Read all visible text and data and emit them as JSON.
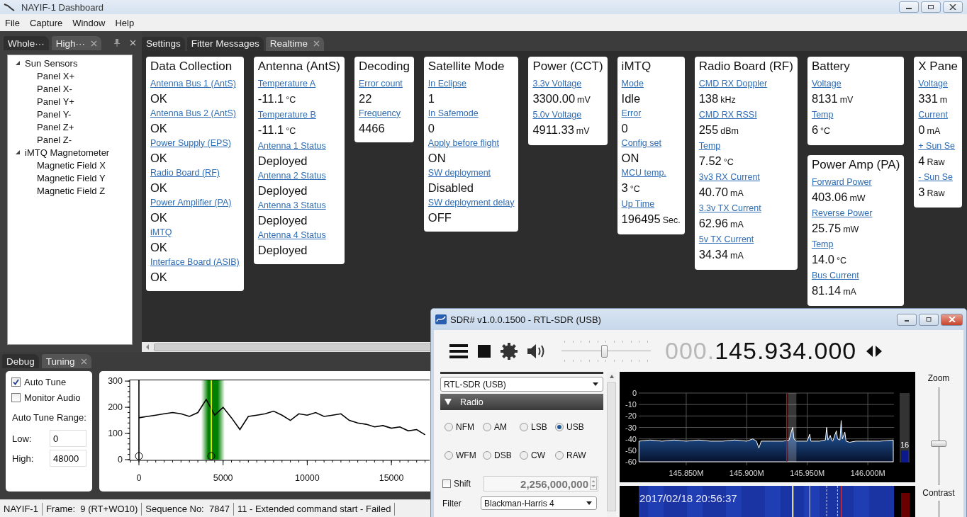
{
  "window": {
    "title": "NAYIF-1 Dashboard"
  },
  "menu": [
    "File",
    "Capture",
    "Window",
    "Help"
  ],
  "left_dock": {
    "tabs": [
      {
        "label": "Whole···",
        "selected": false
      },
      {
        "label": "High···",
        "selected": true
      }
    ],
    "tree": [
      {
        "label": "Sun Sensors",
        "expanded": true,
        "children": [
          {
            "label": "Panel X+"
          },
          {
            "label": "Panel X-"
          },
          {
            "label": "Panel Y+"
          },
          {
            "label": "Panel Y-"
          },
          {
            "label": "Panel Z+"
          },
          {
            "label": "Panel Z-"
          }
        ]
      },
      {
        "label": "iMTQ Magnetometer",
        "expanded": true,
        "children": [
          {
            "label": "Magnetic Field X"
          },
          {
            "label": "Magnetic Field Y"
          },
          {
            "label": "Magnetic Field Z"
          }
        ]
      }
    ]
  },
  "document_tabs": [
    {
      "label": "Settings",
      "selected": false
    },
    {
      "label": "Fitter Messages",
      "selected": false
    },
    {
      "label": "Realtime",
      "selected": true
    }
  ],
  "card_columns": [
    {
      "cards": [
        {
          "title": "Data Collection",
          "fields": [
            {
              "label": "Antenna Bus 1 (AntS)",
              "value": "OK"
            },
            {
              "label": "Antenna Bus 2 (AntS)",
              "value": "OK"
            },
            {
              "label": "Power Supply (EPS)",
              "value": "OK"
            },
            {
              "label": "Radio Board (RF)",
              "value": "OK"
            },
            {
              "label": "Power Amplifier (PA)",
              "value": "OK"
            },
            {
              "label": "iMTQ",
              "value": "OK"
            },
            {
              "label": "Interface Board (ASIB)",
              "value": "OK"
            }
          ]
        }
      ]
    },
    {
      "cards": [
        {
          "title": "Antenna (AntS)",
          "fields": [
            {
              "label": "Temperature A",
              "value": "-11.1",
              "unit": "°C"
            },
            {
              "label": "Temperature B",
              "value": "-11.1",
              "unit": "°C"
            },
            {
              "label": "Antenna 1 Status",
              "value": "Deployed"
            },
            {
              "label": "Antenna 2 Status",
              "value": "Deployed"
            },
            {
              "label": "Antenna 3 Status",
              "value": "Deployed"
            },
            {
              "label": "Antenna 4 Status",
              "value": "Deployed"
            }
          ]
        }
      ]
    },
    {
      "cards": [
        {
          "title": "Decoding",
          "fields": [
            {
              "label": "Error count",
              "value": "22"
            },
            {
              "label": "Frequency",
              "value": "4466"
            }
          ]
        }
      ]
    },
    {
      "cards": [
        {
          "title": "Satellite Mode",
          "fields": [
            {
              "label": "In Eclipse",
              "value": "1"
            },
            {
              "label": "In Safemode",
              "value": "0"
            },
            {
              "label": "Apply before flight",
              "value": "ON"
            },
            {
              "label": "SW deployment",
              "value": "Disabled"
            },
            {
              "label": "SW deployment delay",
              "value": "OFF"
            }
          ]
        }
      ]
    },
    {
      "cards": [
        {
          "title": "Power (CCT)",
          "fields": [
            {
              "label": "3.3v Voltage",
              "value": "3300.00",
              "unit": "mV"
            },
            {
              "label": "5.0v Voltage",
              "value": "4911.33",
              "unit": "mV"
            }
          ]
        }
      ]
    },
    {
      "cards": [
        {
          "title": "iMTQ",
          "fields": [
            {
              "label": "Mode",
              "value": "Idle"
            },
            {
              "label": "Error",
              "value": "0"
            },
            {
              "label": "Config set",
              "value": "ON"
            },
            {
              "label": "MCU temp.",
              "value": "3",
              "unit": "°C"
            },
            {
              "label": "Up Time",
              "value": "196495",
              "unit": "Sec."
            }
          ]
        }
      ]
    },
    {
      "cards": [
        {
          "title": "Radio Board (RF)",
          "fields": [
            {
              "label": "CMD RX Doppler",
              "value": "138",
              "unit": "kHz"
            },
            {
              "label": "CMD RX RSSI",
              "value": "255",
              "unit": "dBm"
            },
            {
              "label": "Temp",
              "value": "7.52",
              "unit": "°C"
            },
            {
              "label": "3v3 RX Current",
              "value": "40.70",
              "unit": "mA"
            },
            {
              "label": "3.3v TX Current",
              "value": "62.96",
              "unit": "mA"
            },
            {
              "label": "5v TX Current",
              "value": "34.34",
              "unit": "mA"
            }
          ]
        }
      ]
    },
    {
      "cards": [
        {
          "title": "Battery",
          "fields": [
            {
              "label": "Voltage",
              "value": "8131",
              "unit": "mV"
            },
            {
              "label": "Temp",
              "value": "6",
              "unit": "°C"
            }
          ]
        },
        {
          "title": "Power Amp (PA)",
          "fields": [
            {
              "label": "Forward Power",
              "value": "403.06",
              "unit": "mW"
            },
            {
              "label": "Reverse Power",
              "value": "25.75",
              "unit": "mW"
            },
            {
              "label": "Temp",
              "value": "14.0",
              "unit": "°C"
            },
            {
              "label": "Bus Current",
              "value": "81.14",
              "unit": "mA"
            }
          ]
        }
      ]
    },
    {
      "cards": [
        {
          "title": "X Pane",
          "fields": [
            {
              "label": "Voltage",
              "value": "331",
              "unit": "m"
            },
            {
              "label": "Current",
              "value": "0",
              "unit": "mA"
            },
            {
              "label": "+ Sun Se",
              "value": "4",
              "unit": "Raw"
            },
            {
              "label": "- Sun Se",
              "value": "3",
              "unit": "Raw"
            }
          ]
        }
      ]
    }
  ],
  "bottom_tabs": [
    {
      "label": "Debug",
      "selected": false
    },
    {
      "label": "Tuning",
      "selected": true
    }
  ],
  "tuning": {
    "checkboxes": [
      {
        "label": "Auto Tune",
        "checked": true
      },
      {
        "label": "Monitor Audio",
        "checked": false
      }
    ],
    "range_label": "Auto Tune Range:",
    "fields": [
      {
        "label": "Low:",
        "value": "0"
      },
      {
        "label": "High:",
        "value": "48000"
      }
    ],
    "chart_data": {
      "type": "line",
      "xlim": [
        -546,
        17270
      ],
      "ylim": [
        0,
        303
      ],
      "xticks": [
        0,
        5000,
        10000,
        15000
      ],
      "yticks": [
        0,
        100,
        200,
        300
      ],
      "x": [
        0,
        500,
        1000,
        1500,
        2000,
        2500,
        3000,
        3500,
        4000,
        4500,
        5000,
        5500,
        6000,
        6500,
        7000,
        7500,
        8000,
        8500,
        9000,
        9500,
        10000,
        10500,
        11000,
        11500,
        12000,
        12500,
        13000,
        13500,
        14000,
        14500,
        15000,
        15500,
        16000,
        16500,
        17000
      ],
      "series": [
        {
          "color": "#000000",
          "values": [
            160,
            165,
            170,
            175,
            180,
            175,
            165,
            180,
            230,
            170,
            200,
            160,
            115,
            165,
            170,
            175,
            185,
            170,
            150,
            175,
            170,
            180,
            165,
            170,
            175,
            150,
            140,
            135,
            125,
            130,
            120,
            125,
            110,
            115,
            95
          ]
        }
      ],
      "bands": [
        {
          "axis": "x",
          "from": 3700,
          "to": 5100
        }
      ],
      "ref_lines": [
        {
          "axis": "x",
          "value": 0,
          "color": "#000000"
        },
        {
          "axis": "x",
          "value": 4300,
          "color": "#ffff00"
        }
      ]
    }
  },
  "status_bar": [
    "NAYIF-1",
    "Frame:  9 (RT+WO10)",
    "Sequence No:  7847",
    "11 - Extended command start - Failed"
  ],
  "sdr": {
    "title": "SDR# v1.0.0.1500 - RTL-SDR (USB)",
    "volume": {
      "level": 0.48
    },
    "frequency": {
      "prefix": "000.",
      "value": "145.934.000"
    },
    "device": "RTL-SDR (USB)",
    "section": {
      "title": "Radio",
      "expanded": true
    },
    "modes": [
      {
        "label": "NFM",
        "selected": false
      },
      {
        "label": "AM",
        "selected": false
      },
      {
        "label": "LSB",
        "selected": false
      },
      {
        "label": "USB",
        "selected": true
      },
      {
        "label": "WFM",
        "selected": false
      },
      {
        "label": "DSB",
        "selected": false
      },
      {
        "label": "CW",
        "selected": false
      },
      {
        "label": "RAW",
        "selected": false
      }
    ],
    "shift": {
      "label": "Shift",
      "checked": false,
      "value": "2,256,000,000"
    },
    "filter": {
      "label": "Filter",
      "value": "Blackman-Harris 4"
    },
    "spectrum": {
      "chart_data": {
        "type": "area",
        "xlim": [
          145.8108,
          146.0216
        ],
        "ylim": [
          -60,
          0
        ],
        "xticks": [
          {
            "value": 145.85,
            "label": "145.850M"
          },
          {
            "value": 145.9,
            "label": "145.900M"
          },
          {
            "value": 145.95,
            "label": "145.950M"
          },
          {
            "value": 146.0,
            "label": "146.000M"
          }
        ],
        "yticks": [
          0,
          -10,
          -20,
          -30,
          -40,
          -50,
          -60
        ],
        "grid": true,
        "x": [
          145.811,
          145.811,
          145.82,
          145.83,
          145.84,
          145.85,
          145.86,
          145.87,
          145.88,
          145.89,
          145.9,
          145.905,
          145.908,
          145.91,
          145.912,
          145.92,
          145.93,
          145.935,
          145.937,
          145.938,
          145.939,
          145.941,
          145.95,
          145.952,
          145.953,
          145.96,
          145.965,
          145.966,
          145.967,
          145.969,
          145.97,
          145.971,
          145.974,
          145.975,
          145.977,
          145.978,
          145.979,
          145.981,
          145.982,
          145.985,
          145.99,
          146.0,
          146.01,
          146.021,
          146.021
        ],
        "series": [
          {
            "color": "#ffffff",
            "values": [
              -60,
              -42,
              -41,
              -42,
              -41,
              -42,
              -41,
              -42,
              -42,
              -41,
              -42,
              -40,
              -42,
              -48,
              -42,
              -42,
              -42,
              -41,
              -33,
              -30,
              -40,
              -42,
              -42,
              -36,
              -42,
              -42,
              -41,
              -30,
              -41,
              -37,
              -41,
              -42,
              -33,
              -40,
              -41,
              -24,
              -40,
              -34,
              -42,
              -43,
              -42,
              -42,
              -42,
              -41,
              -60
            ]
          }
        ],
        "ref_lines": [
          {
            "axis": "x",
            "value": 145.933,
            "color": "#ff0000"
          }
        ],
        "bands": [
          {
            "axis": "x",
            "from": 145.934,
            "to": 145.941
          }
        ]
      },
      "meter": {
        "level": 0.17,
        "reading": "16"
      }
    },
    "waterfall": {
      "timestamp": "2017/02/18 20:56:37"
    },
    "zoom": {
      "label": "Zoom",
      "level": 0.42
    },
    "contrast": {
      "label": "Contrast"
    }
  }
}
